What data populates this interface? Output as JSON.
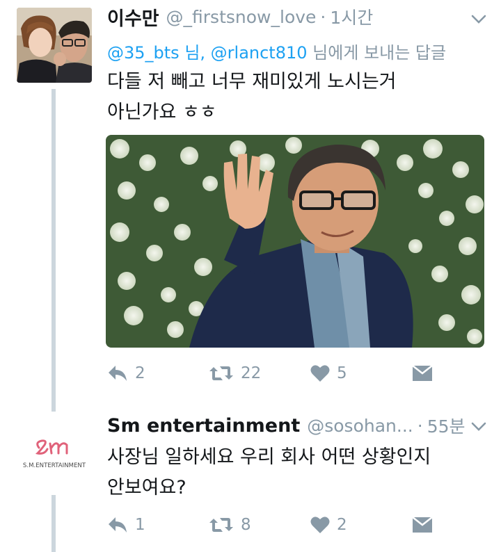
{
  "tweets": [
    {
      "display_name": "이수만",
      "handle": "@_firstsnow_love",
      "separator": "·",
      "time": "1시간",
      "reply_prefix": "@35_bts 님, @rlanct810",
      "reply_suffix": " 님에게 보내는 답글",
      "text_line1": "다들 저 빼고 너무 재미있게 노시는거",
      "text_line2": "아닌가요 ㅎㅎ",
      "avatar_icon": "profile-photo-two-people",
      "media_icon": "photo-man-waving-glasses",
      "stats": {
        "replies": "2",
        "retweets": "22",
        "likes": "5"
      }
    },
    {
      "display_name": "Sm entertainment",
      "handle": "@sosohan...",
      "separator": "·",
      "time": "55분",
      "avatar_logo_text": "S.M.ENTERTAINMENT",
      "text_line1": "사장님 일하세요 우리 회사 어떤 상황인지",
      "text_line2": "안보여요?",
      "stats": {
        "replies": "1",
        "retweets": "8",
        "likes": "2"
      }
    }
  ],
  "colors": {
    "text": "#14171a",
    "muted": "#8899a6",
    "link": "#1da1f2",
    "thread_line": "#ccd6dd",
    "sm_logo": "#e0627a"
  },
  "icons": [
    "reply-icon",
    "retweet-icon",
    "heart-icon",
    "dm-envelope-icon",
    "chevron-down-icon"
  ]
}
